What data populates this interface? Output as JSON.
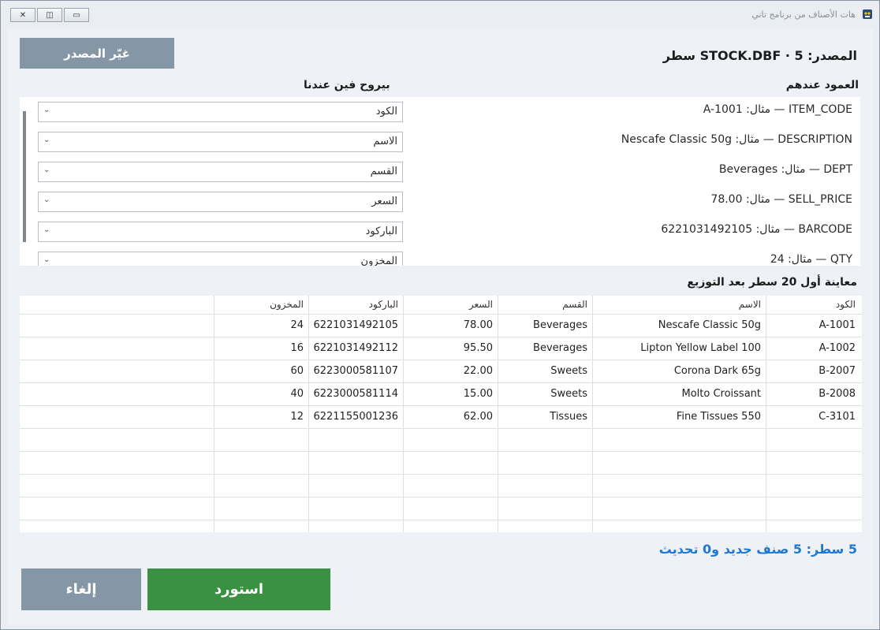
{
  "window": {
    "title": "هات الأصناف من برنامج تاني",
    "controls": {
      "minimize": "▭",
      "maximize": "◫",
      "close": "✕"
    }
  },
  "source": {
    "label": "المصدر: STOCK.DBF · 5 سطر",
    "change_button": "غيّر المصدر"
  },
  "mapping": {
    "header_theirs": "العمود عندهم",
    "header_ours": "بيروح فين عندنا",
    "rows": [
      {
        "desc": "ITEM_CODE — مثال: A-1001",
        "target": "الكود"
      },
      {
        "desc": "DESCRIPTION — مثال: Nescafe Classic 50g",
        "target": "الاسم"
      },
      {
        "desc": "DEPT — مثال: Beverages",
        "target": "القسم"
      },
      {
        "desc": "SELL_PRICE — مثال: 78.00",
        "target": "السعر"
      },
      {
        "desc": "BARCODE — مثال: 6221031492105",
        "target": "الباركود"
      },
      {
        "desc": "QTY — مثال: 24",
        "target": "المخزون"
      }
    ]
  },
  "preview": {
    "title": "معاينة أول 20 سطر بعد التوزيع",
    "columns": [
      "الكود",
      "الاسم",
      "القسم",
      "السعر",
      "الباركود",
      "المخزون"
    ],
    "rows": [
      [
        "A-1001",
        "Nescafe Classic 50g",
        "Beverages",
        "78.00",
        "6221031492105",
        "24"
      ],
      [
        "A-1002",
        "Lipton Yellow Label 100",
        "Beverages",
        "95.50",
        "6221031492112",
        "16"
      ],
      [
        "B-2007",
        "Corona Dark 65g",
        "Sweets",
        "22.00",
        "6223000581107",
        "60"
      ],
      [
        "B-2008",
        "Molto Croissant",
        "Sweets",
        "15.00",
        "6223000581114",
        "40"
      ],
      [
        "C-3101",
        "Fine Tissues 550",
        "Tissues",
        "62.00",
        "6221155001236",
        "12"
      ]
    ]
  },
  "summary": "5 سطر: 5 صنف جديد و0 تحديث",
  "actions": {
    "import": "استورد",
    "cancel": "إلغاء"
  },
  "colors": {
    "accent_blue": "#1f78d1",
    "import_green": "#3a9142",
    "neutral_button": "#8597a6"
  }
}
